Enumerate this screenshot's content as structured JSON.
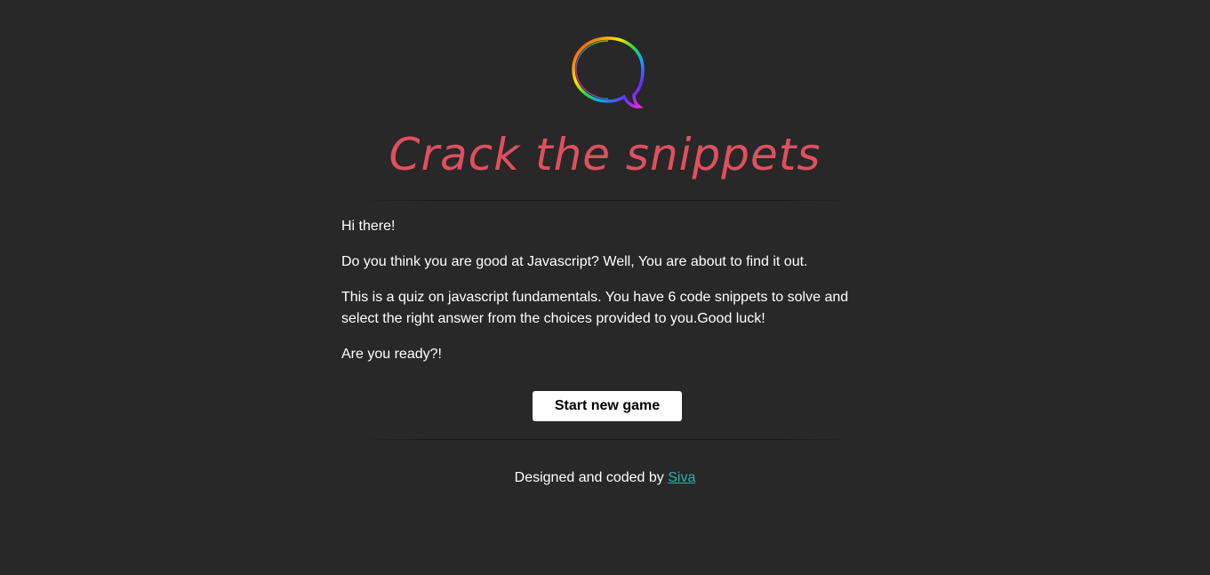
{
  "logo": {
    "icon": "rainbow-q-speech-bubble-icon"
  },
  "title": "Crack the snippets",
  "intro": {
    "greeting": "Hi there!",
    "question": "Do you think you are good at Javascript? Well, You are about to find it out.",
    "description": "This is a quiz on javascript fundamentals. You have 6 code snippets to solve and select the right answer from the choices provided to you.Good luck!",
    "prompt": "Are you ready?!"
  },
  "start_button_label": "Start new game",
  "footer": {
    "text": "Designed and coded by ",
    "author_link": "Siva"
  },
  "colors": {
    "background": "#282828",
    "title": "#e0505e",
    "link": "#2ab0b0",
    "button_bg": "#ffffff"
  }
}
